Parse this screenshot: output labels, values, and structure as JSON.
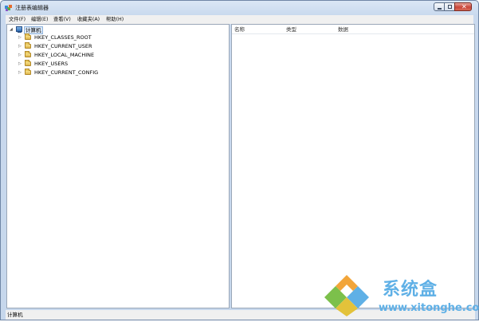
{
  "window": {
    "title": "注册表编辑器",
    "controls": {
      "minimize": "minimize",
      "maximize": "maximize",
      "close": "✕"
    }
  },
  "menu": [
    {
      "label": "文件(F)"
    },
    {
      "label": "编辑(E)"
    },
    {
      "label": "查看(V)"
    },
    {
      "label": "收藏夹(A)"
    },
    {
      "label": "帮助(H)"
    }
  ],
  "tree": {
    "root": {
      "label": "计算机",
      "expander": "◢",
      "icon": "computer-icon"
    },
    "children": [
      {
        "label": "HKEY_CLASSES_ROOT",
        "expander": "▷",
        "icon": "folder-icon"
      },
      {
        "label": "HKEY_CURRENT_USER",
        "expander": "▷",
        "icon": "folder-icon"
      },
      {
        "label": "HKEY_LOCAL_MACHINE",
        "expander": "▷",
        "icon": "folder-icon"
      },
      {
        "label": "HKEY_USERS",
        "expander": "▷",
        "icon": "folder-icon"
      },
      {
        "label": "HKEY_CURRENT_CONFIG",
        "expander": "▷",
        "icon": "folder-icon"
      }
    ]
  },
  "list": {
    "columns": [
      "名称",
      "类型",
      "数据"
    ]
  },
  "status": {
    "text": "计算机"
  },
  "watermark": {
    "brand": "系统盒",
    "url": "www.xitonghe.com",
    "color": "#5fb0e6"
  }
}
